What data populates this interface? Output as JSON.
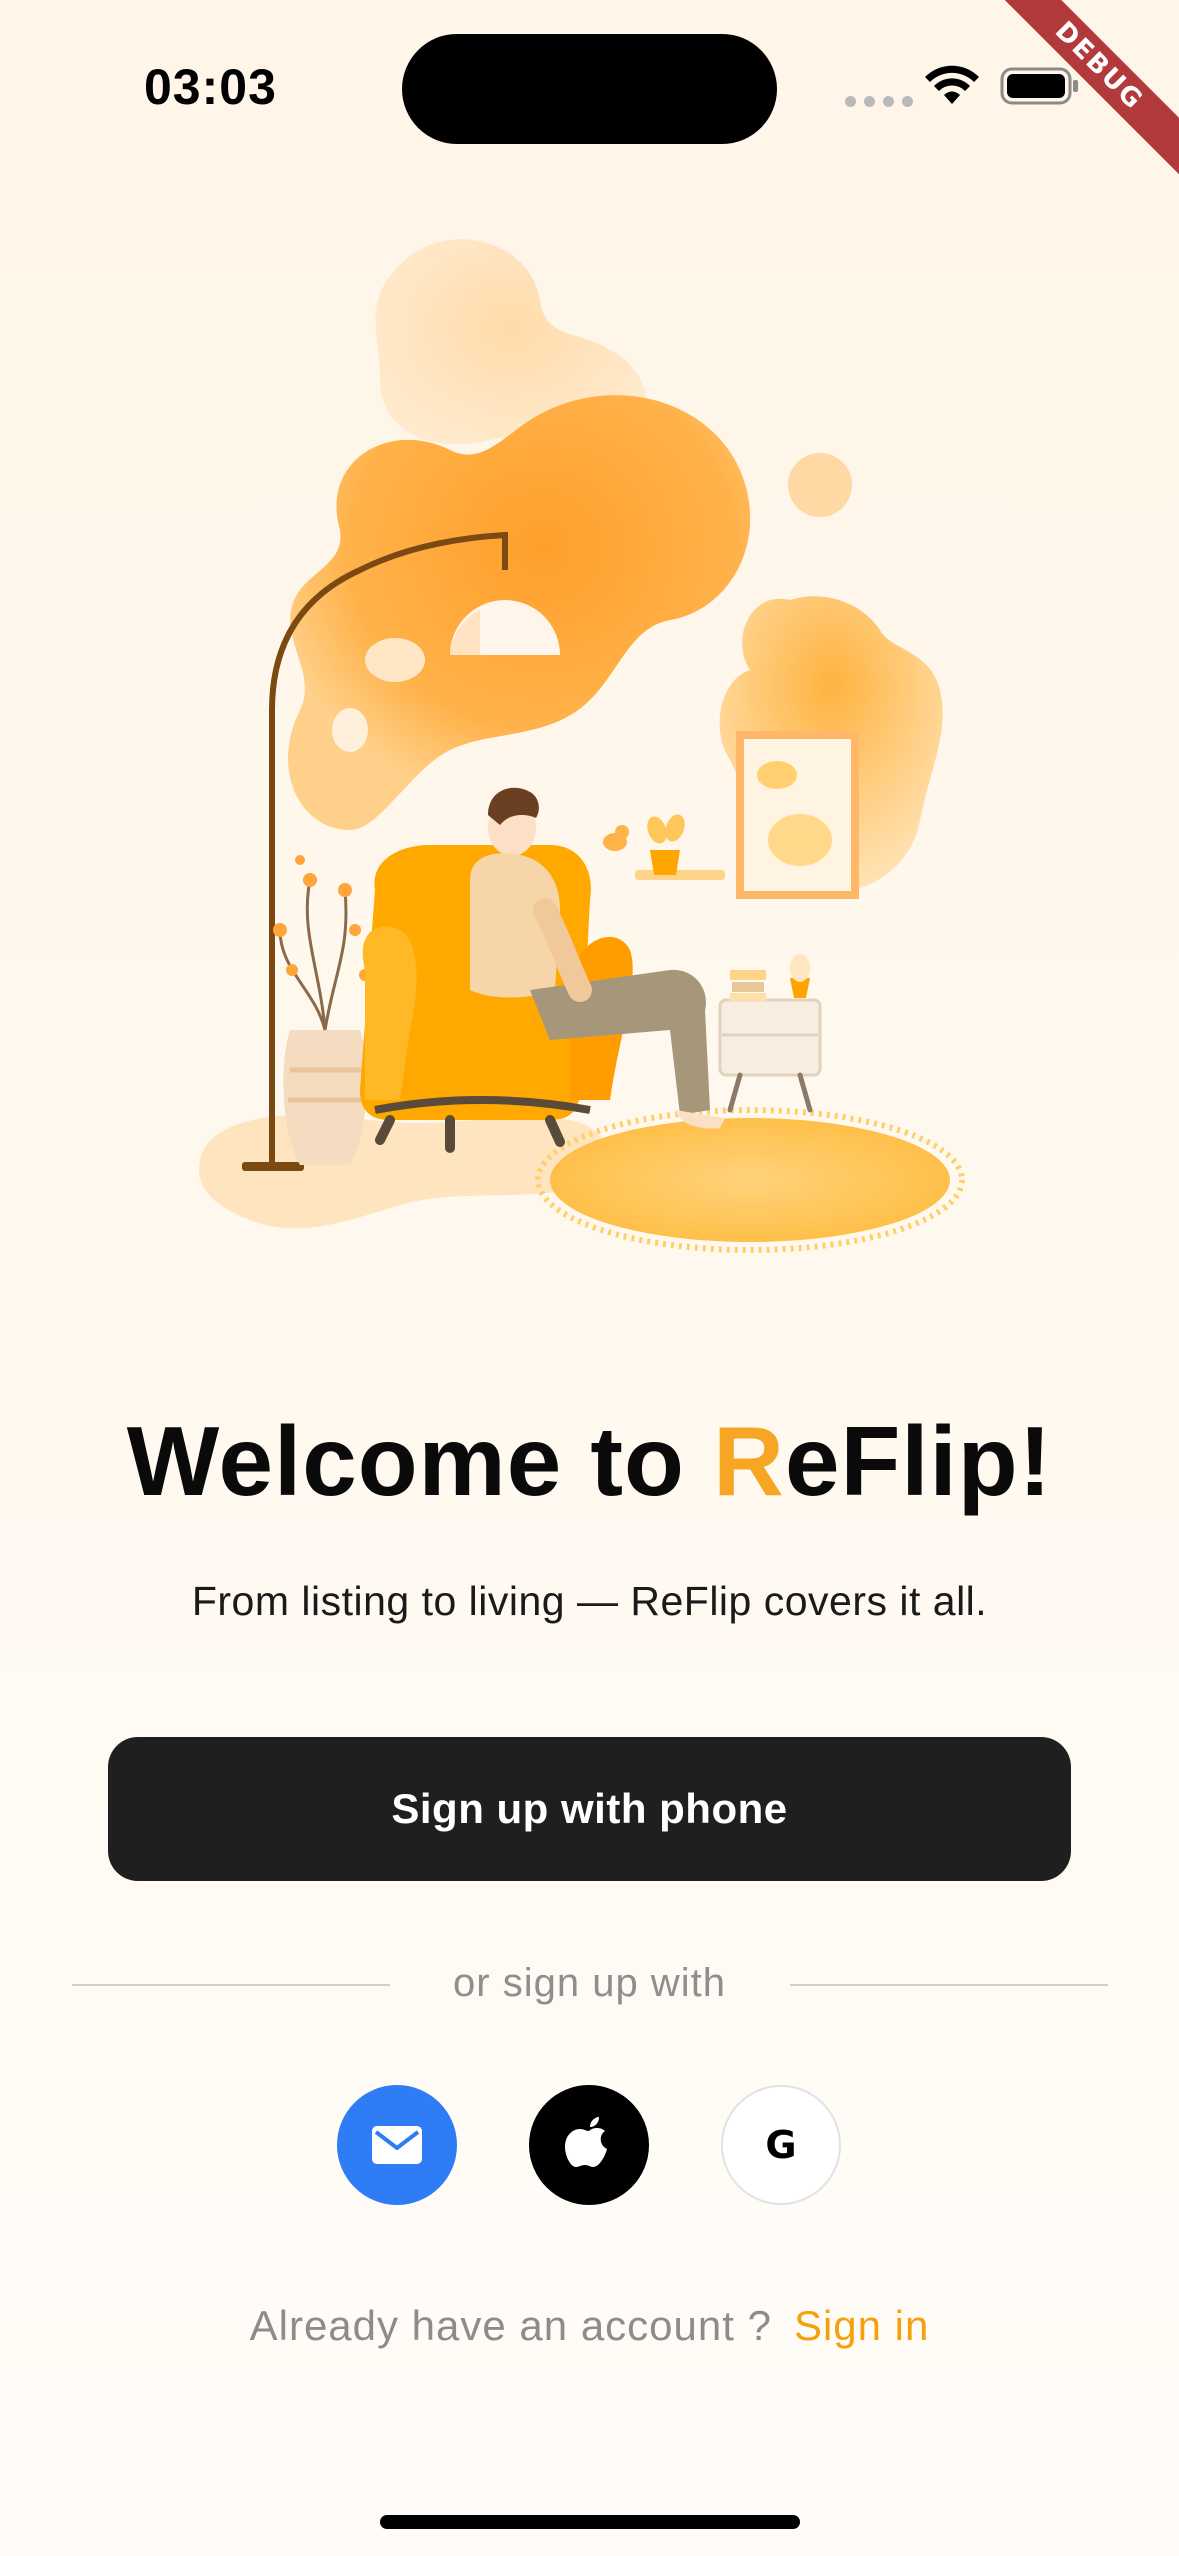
{
  "status_bar": {
    "time": "03:03",
    "debug_label": "DEBUG"
  },
  "welcome": {
    "title_prefix": "Welcome to ",
    "title_accent": "R",
    "title_suffix": "eFlip!",
    "subtitle": "From listing to living — ReFlip covers it all."
  },
  "primary_button": {
    "label": "Sign up with phone"
  },
  "divider": {
    "text": "or sign up with"
  },
  "social": {
    "email_icon": "mail-icon",
    "apple_icon": "apple-icon",
    "google_icon": "google-icon",
    "google_glyph": "G",
    "email_color": "#2e7cf6",
    "apple_color": "#000000",
    "google_color": "#ffffff"
  },
  "signin": {
    "prompt": "Already have an account ?",
    "link": "Sign in"
  },
  "colors": {
    "accent": "#f6a623",
    "button_dark": "#1f1f1f",
    "background": "#fff6ea"
  }
}
